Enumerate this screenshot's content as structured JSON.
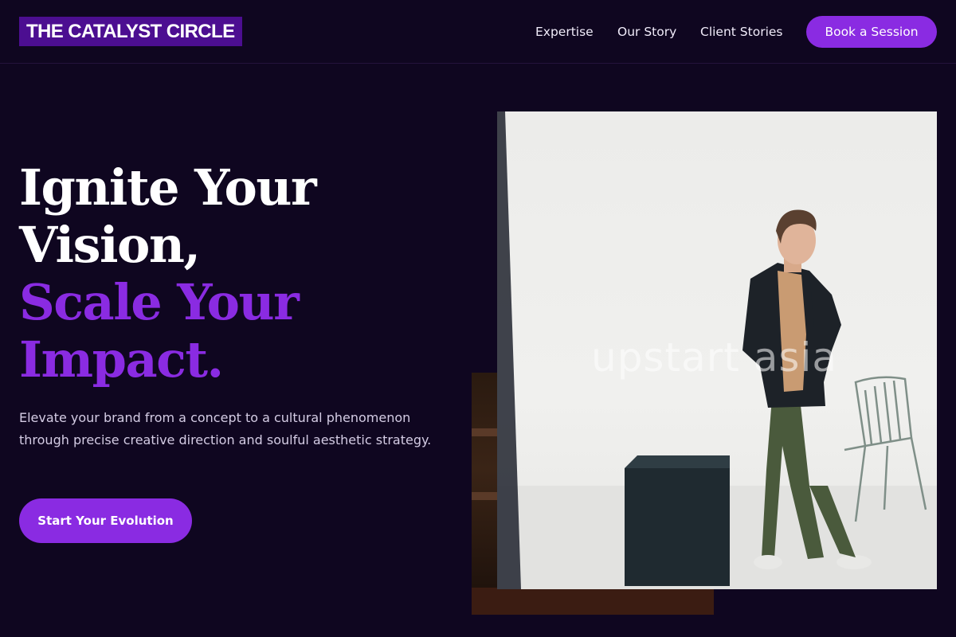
{
  "header": {
    "logo": "THE CATALYST CIRCLE",
    "nav": {
      "expertise": "Expertise",
      "story": "Our Story",
      "clients": "Client Stories"
    },
    "cta": "Book a Session"
  },
  "hero": {
    "headline": {
      "line1": "Ignite Your",
      "line2": "Vision,",
      "line3": "Scale Your",
      "line4": "Impact."
    },
    "description": "Elevate your brand from a concept to a cultural phenomenon through precise creative direction and soulful aesthetic strategy.",
    "cta": "Start Your Evolution"
  },
  "image": {
    "watermark": "upstart asia"
  },
  "colors": {
    "background": "#0f0620",
    "accent": "#8a2be2",
    "logo_bg": "#4c0e91"
  }
}
